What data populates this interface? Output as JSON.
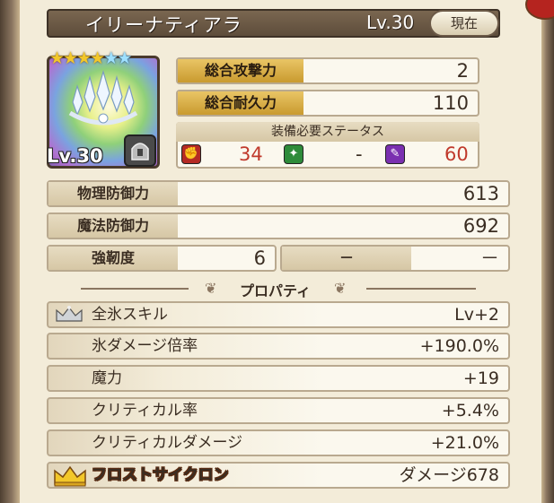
{
  "header": {
    "name": "イリーナティアラ",
    "level": "Lv.30",
    "current_label": "現在"
  },
  "icon": {
    "level_label": "Lv.30",
    "stars": [
      "star-gold",
      "star-gold",
      "star-gold",
      "star-gold",
      "star-blue",
      "star-blue"
    ]
  },
  "main_stats": [
    {
      "label": "総合攻撃力",
      "value": "2"
    },
    {
      "label": "総合耐久力",
      "value": "110"
    }
  ],
  "required": {
    "title": "装備必要ステータス",
    "items": [
      {
        "icon": "fist-icon",
        "value": "34",
        "color": "#c0392b"
      },
      {
        "icon": "sparkle-icon",
        "value": "-",
        "color": "#3a2d22"
      },
      {
        "icon": "wand-icon",
        "value": "60",
        "color": "#c0392b"
      }
    ]
  },
  "defense": [
    {
      "label": "物理防御力",
      "value": "613"
    },
    {
      "label": "魔法防御力",
      "value": "692"
    }
  ],
  "toughness": {
    "label": "強靭度",
    "value": "6",
    "slot2_label": "－",
    "slot2_value": "－"
  },
  "properties_title": "プロパティ",
  "properties": [
    {
      "label": "全氷スキル",
      "value": "Lv+2"
    },
    {
      "label": "氷ダメージ倍率",
      "value": "+190.0%"
    },
    {
      "label": "魔力",
      "value": "+19"
    },
    {
      "label": "クリティカル率",
      "value": "+5.4%"
    },
    {
      "label": "クリティカルダメージ",
      "value": "+21.0%"
    }
  ],
  "ultimate": {
    "label": "フロストサイクロン",
    "value": "ダメージ678"
  }
}
